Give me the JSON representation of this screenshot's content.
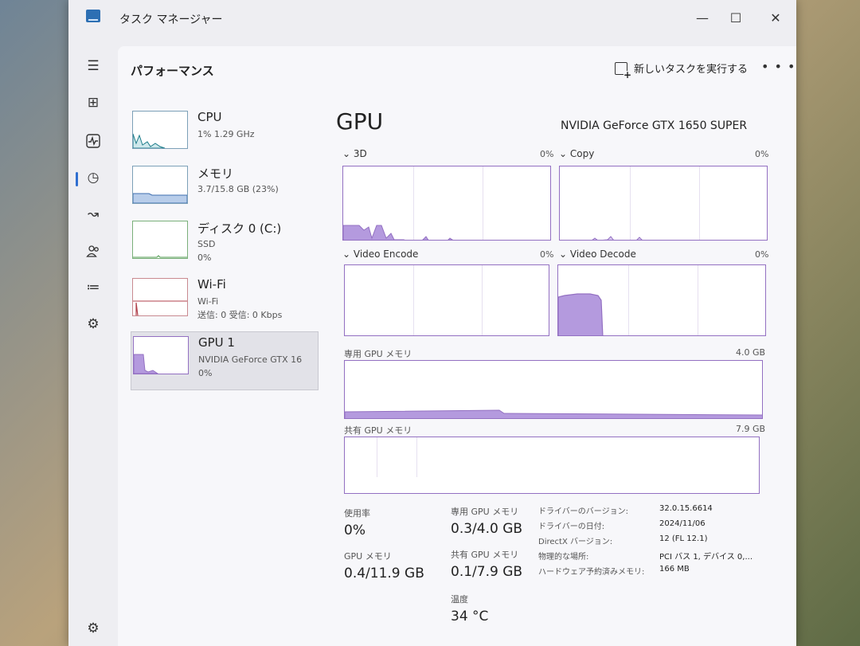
{
  "window": {
    "title": "タスク マネージャー"
  },
  "header": {
    "page_title": "パフォーマンス",
    "run_task_label": "新しいタスクを実行する"
  },
  "devices": [
    {
      "name": "CPU",
      "line1": "1%  1.29 GHz",
      "line2": "",
      "line3": ""
    },
    {
      "name": "メモリ",
      "line1": "3.7/15.8 GB (23%)",
      "line2": "",
      "line3": ""
    },
    {
      "name": "ディスク 0 (C:)",
      "line1": "SSD",
      "line2": "0%",
      "line3": ""
    },
    {
      "name": "Wi-Fi",
      "line1": "Wi-Fi",
      "line2": "送信: 0  受信: 0 Kbps",
      "line3": ""
    },
    {
      "name": "GPU 1",
      "line1": "NVIDIA GeForce GTX 16",
      "line2": "0%",
      "line3": ""
    }
  ],
  "gpu": {
    "title": "GPU",
    "model": "NVIDIA GeForce GTX 1650 SUPER",
    "engines": [
      {
        "label": "⌄ 3D",
        "value": "0%"
      },
      {
        "label": "⌄ Copy",
        "value": "0%"
      },
      {
        "label": "⌄ Video Encode",
        "value": "0%"
      },
      {
        "label": "⌄ Video Decode",
        "value": "0%"
      }
    ],
    "dedicated": {
      "label": "専用 GPU メモリ",
      "max": "4.0 GB"
    },
    "shared": {
      "label": "共有 GPU メモリ",
      "max": "7.9 GB"
    }
  },
  "stats": {
    "usage_label": "使用率",
    "usage": "0%",
    "dedicated_label": "専用 GPU メモリ",
    "dedicated": "0.3/4.0 GB",
    "gpumem_label": "GPU メモリ",
    "gpumem": "0.4/11.9 GB",
    "shared_label": "共有 GPU メモリ",
    "shared": "0.1/7.9 GB",
    "temp_label": "温度",
    "temp": "34 °C"
  },
  "details": [
    {
      "label": "ドライバーのバージョン:",
      "value": "32.0.15.6614"
    },
    {
      "label": "ドライバーの日付:",
      "value": "2024/11/06"
    },
    {
      "label": "DirectX バージョン:",
      "value": "12 (FL 12.1)"
    },
    {
      "label": "物理的な場所:",
      "value": "PCI バス 1, デバイス 0,..."
    },
    {
      "label": "ハードウェア予約済みメモリ:",
      "value": "166 MB"
    }
  ],
  "colors": {
    "gpu_accent": "#9370c2",
    "gpu_fill": "#b49ade",
    "cpu": "#1e7d8a",
    "memory": "#3f6fb0",
    "wifi": "#b0414c"
  },
  "icons": [
    "menu-icon",
    "processes-icon",
    "performance-icon",
    "app-history-icon",
    "startup-apps-icon",
    "users-icon",
    "details-icon",
    "services-icon",
    "settings-icon"
  ]
}
